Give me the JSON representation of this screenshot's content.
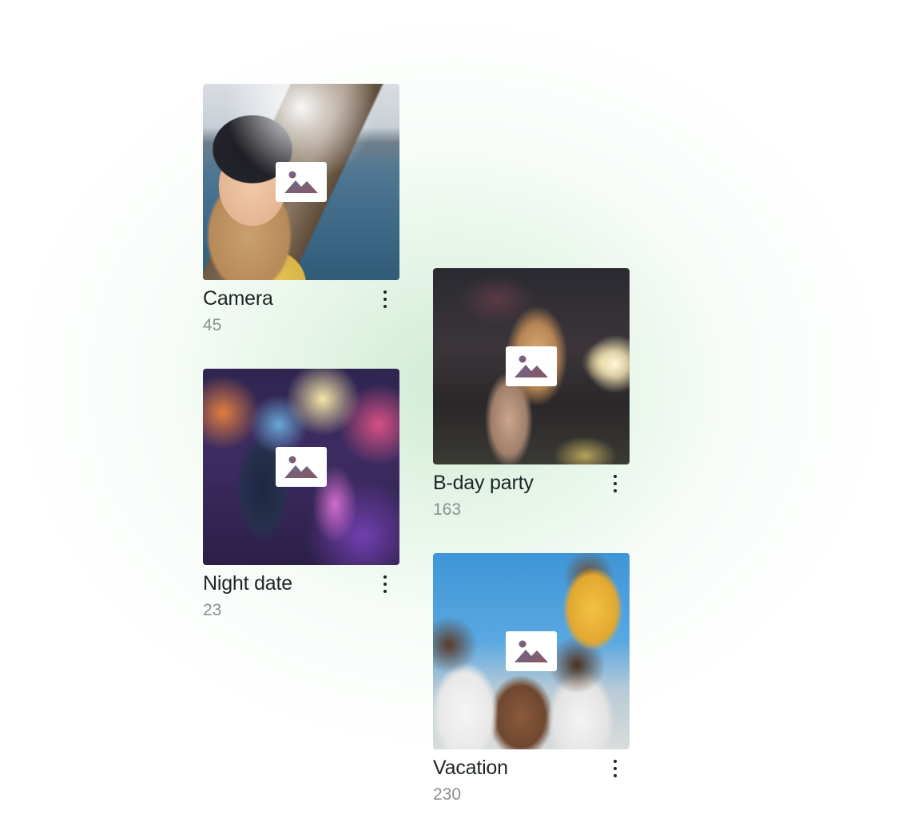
{
  "albums": [
    {
      "title": "Camera",
      "count": "45",
      "thumbnail_icon": "image-placeholder-icon",
      "menu_icon": "more-vertical-icon"
    },
    {
      "title": "B-day party",
      "count": "163",
      "thumbnail_icon": "image-placeholder-icon",
      "menu_icon": "more-vertical-icon"
    },
    {
      "title": "Night date",
      "count": "23",
      "thumbnail_icon": "image-placeholder-icon",
      "menu_icon": "more-vertical-icon"
    },
    {
      "title": "Vacation",
      "count": "230",
      "thumbnail_icon": "image-placeholder-icon",
      "menu_icon": "more-vertical-icon"
    }
  ],
  "colors": {
    "title_text": "#1f2426",
    "count_text": "#8a8f91",
    "background_glow": "#d6eedb",
    "icon_gradient_start": "#6b6a8f",
    "icon_gradient_end": "#8a5560"
  }
}
